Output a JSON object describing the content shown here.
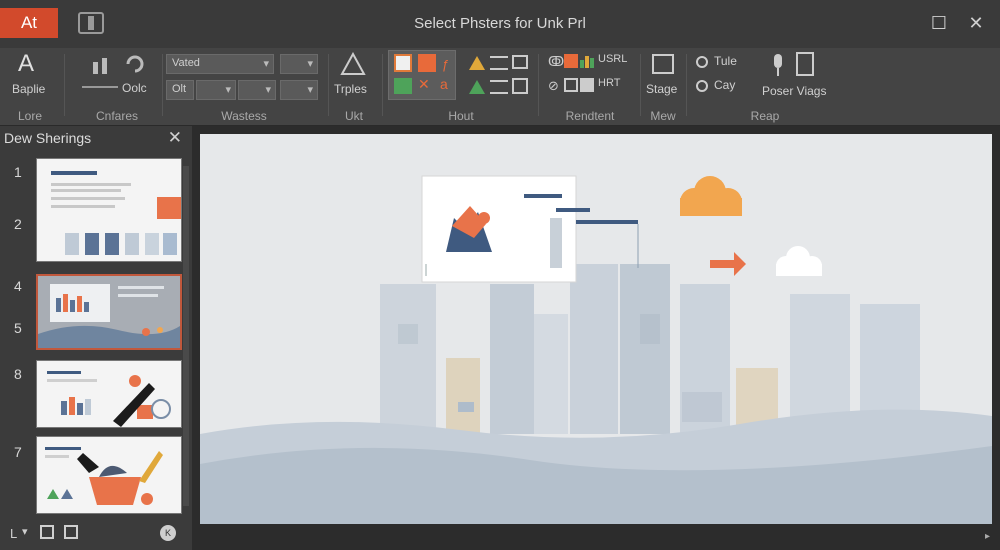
{
  "app": {
    "badge": "At",
    "window_title": "Select Phsters for Unk Prl",
    "window_controls": [
      "maximize-icon",
      "close-icon"
    ]
  },
  "ribbon": {
    "groups": [
      {
        "label": "Lore",
        "button": "Baplie"
      },
      {
        "label": "Cnfares",
        "button": "Oolc"
      },
      {
        "label": "Wastess",
        "dropdown_1": "Vated",
        "dropdown_2": "Olt"
      },
      {
        "label": "Ukt",
        "button": "Trples"
      },
      {
        "label": "Hout"
      },
      {
        "label": "Rendtent",
        "text_1": "USRL",
        "text_2": "HRT"
      },
      {
        "label": "Mew",
        "button": "Stage"
      },
      {
        "label": "Reap",
        "radio_1": "Tule",
        "radio_2": "Cay",
        "button": "Poser Viags"
      }
    ]
  },
  "left_panel": {
    "title": "Dew Sherings",
    "slide_numbers": [
      "1",
      "2",
      "4",
      "5",
      "8",
      "7"
    ],
    "bottom_items": [
      "L",
      "icon",
      "icon",
      "K"
    ]
  },
  "colors": {
    "accent": "#d24a2c",
    "ribbon_bg": "#444444",
    "slide_bg": "#e6e8ea",
    "orange": "#e8734a",
    "cloud_orange": "#f2a64f",
    "navy": "#3f5a80"
  }
}
